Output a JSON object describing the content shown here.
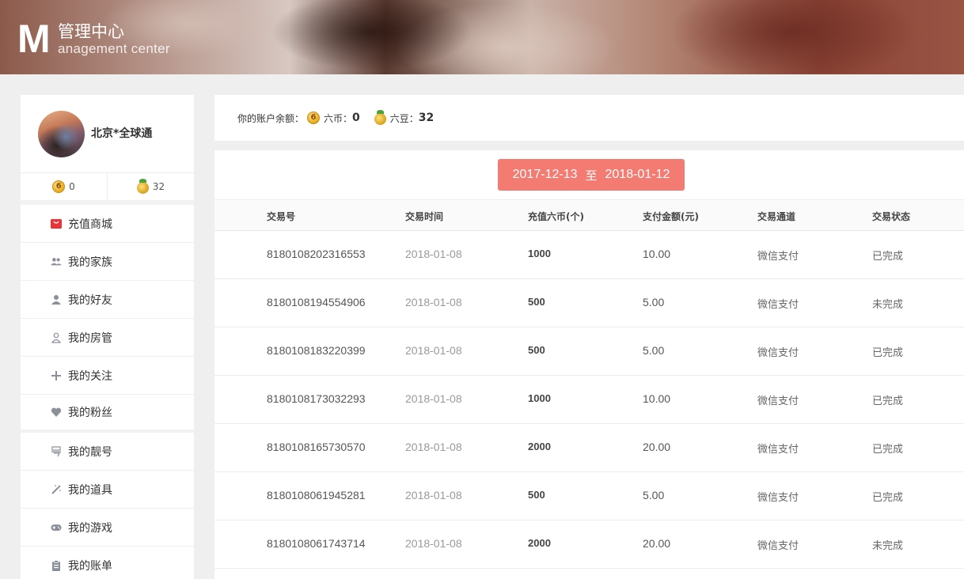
{
  "header": {
    "logo_letter": "M",
    "title_cn": "管理中心",
    "title_en": "anagement center"
  },
  "sidebar": {
    "username": "北京*全球通",
    "coins": "0",
    "beans": "32",
    "items": [
      {
        "label": "充值商城",
        "icon": "shop-icon"
      },
      {
        "label": "我的家族",
        "icon": "family-icon"
      },
      {
        "label": "我的好友",
        "icon": "friend-icon"
      },
      {
        "label": "我的房管",
        "icon": "admin-icon"
      },
      {
        "label": "我的关注",
        "icon": "plus-icon"
      },
      {
        "label": "我的粉丝",
        "icon": "heart-icon"
      },
      {
        "label": "我的靓号",
        "icon": "number-icon"
      },
      {
        "label": "我的道具",
        "icon": "wand-icon"
      },
      {
        "label": "我的游戏",
        "icon": "gamepad-icon"
      },
      {
        "label": "我的账单",
        "icon": "bill-icon"
      }
    ]
  },
  "account": {
    "label": "你的账户余额：",
    "coin_label": "六币：",
    "coin_value": "0",
    "bean_label": "六豆：",
    "bean_value": "32"
  },
  "date_range": {
    "start": "2017-12-13",
    "sep": "至",
    "end": "2018-01-12"
  },
  "table": {
    "headers": [
      "交易号",
      "交易时间",
      "充值六币(个)",
      "支付金额(元)",
      "交易通道",
      "交易状态"
    ],
    "rows": [
      {
        "id": "8180108202316553",
        "time": "2018-01-08",
        "coins": "1000",
        "amount": "10.00",
        "channel": "微信支付",
        "status": "已完成"
      },
      {
        "id": "8180108194554906",
        "time": "2018-01-08",
        "coins": "500",
        "amount": "5.00",
        "channel": "微信支付",
        "status": "未完成"
      },
      {
        "id": "8180108183220399",
        "time": "2018-01-08",
        "coins": "500",
        "amount": "5.00",
        "channel": "微信支付",
        "status": "已完成"
      },
      {
        "id": "8180108173032293",
        "time": "2018-01-08",
        "coins": "1000",
        "amount": "10.00",
        "channel": "微信支付",
        "status": "已完成"
      },
      {
        "id": "8180108165730570",
        "time": "2018-01-08",
        "coins": "2000",
        "amount": "20.00",
        "channel": "微信支付",
        "status": "已完成"
      },
      {
        "id": "8180108061945281",
        "time": "2018-01-08",
        "coins": "500",
        "amount": "5.00",
        "channel": "微信支付",
        "status": "已完成"
      },
      {
        "id": "8180108061743714",
        "time": "2018-01-08",
        "coins": "2000",
        "amount": "20.00",
        "channel": "微信支付",
        "status": "未完成"
      }
    ]
  },
  "colors": {
    "accent": "#f47b72",
    "shop_icon": "#e8333a",
    "icon_gray": "#8a8f99"
  }
}
